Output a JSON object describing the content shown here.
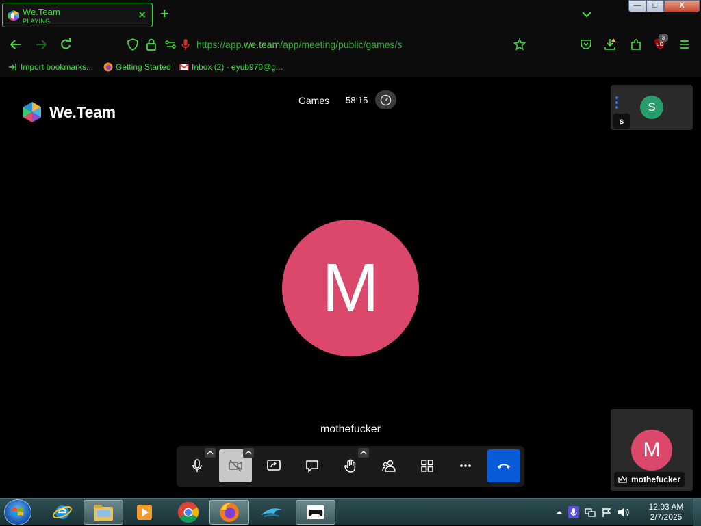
{
  "browser": {
    "tab": {
      "title": "We.Team",
      "status": "PLAYING"
    },
    "address": {
      "url_prefix": "https://app.",
      "url_domain": "we.team",
      "url_path": "/app/meeting/public/games/s"
    },
    "bookmarks": [
      {
        "label": "Import bookmarks...",
        "icon": "import-icon"
      },
      {
        "label": "Getting Started",
        "icon": "firefox-icon"
      },
      {
        "label": "Inbox (2) - eyub970@g...",
        "icon": "gmail-icon"
      }
    ],
    "ublock_count": "3",
    "window_controls": {
      "minimize": "—",
      "maximize": "□",
      "close": "X"
    }
  },
  "app": {
    "logo_text": "We.Team",
    "header": {
      "section": "Games",
      "timer": "58:15"
    },
    "peer": {
      "initial": "S",
      "name": "s",
      "avatar_color": "#2a9d6c"
    },
    "main": {
      "initial": "M",
      "name": "mothefucker",
      "avatar_color": "#dc486c"
    },
    "self": {
      "initial": "M",
      "name": "mothefucker"
    },
    "toolbar": [
      "mic-icon",
      "camera-off-icon",
      "screen-share-icon",
      "chat-icon",
      "raise-hand-icon",
      "participants-icon",
      "grid-view-icon",
      "more-icon",
      "hang-up-icon"
    ]
  },
  "taskbar": {
    "apps": [
      "ie-icon",
      "explorer-icon",
      "media-player-icon",
      "chrome-icon",
      "firefox-icon",
      "dolphin-icon",
      "gamepad-icon"
    ],
    "clock": {
      "time": "12:03 AM",
      "date": "2/7/2025"
    }
  },
  "colors": {
    "accent": "#3fe03f",
    "hangup": "#0a5bd8"
  }
}
